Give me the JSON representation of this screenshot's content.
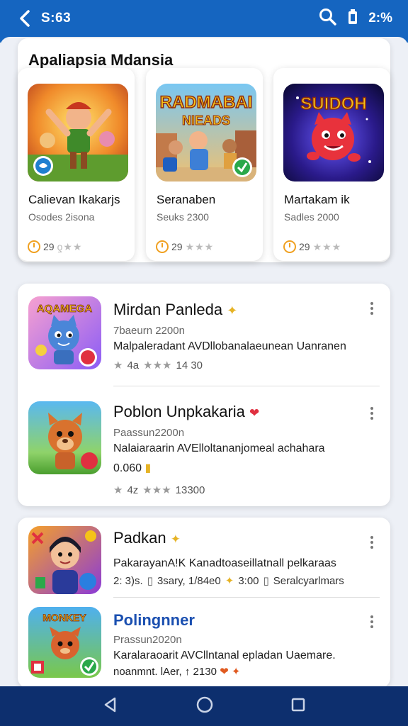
{
  "status_bar": {
    "title": "S:63",
    "battery_text": "2:%",
    "icons": [
      "back-arrow-icon",
      "search-icon",
      "battery-icon"
    ]
  },
  "featured": {
    "section_title": "Apaliapsia Mdansia",
    "items": [
      {
        "name": "Calievan Ikakarjs",
        "sub": "Osodes 2isona",
        "rating_text": "29"
      },
      {
        "name": "Seranaben",
        "sub": "Seuks 2300",
        "rating_text": "29"
      },
      {
        "name": "Martakam ik",
        "sub": "Sadles 2000",
        "rating_text": "29"
      }
    ],
    "art_texts": [
      "RADMABAI",
      "NIEADS",
      "SUIDOH"
    ]
  },
  "list_top": [
    {
      "title": "Mirdan Panleda",
      "line1": "7baeurn 2200n",
      "line2": "Malpaleradant AVDllobanalaeunean Uanranen",
      "meta_count": "14 30",
      "meta_left": "4a"
    },
    {
      "title": "Poblon Unpkakaria",
      "line1": "Paassun2200n",
      "line2": "Nalaiaraarin AVElloltananjomeal achahara",
      "line3": "0.060",
      "meta_count": "13300",
      "meta_left": "4z"
    }
  ],
  "list_bottom": [
    {
      "title": "Padkan",
      "line1": "PakarayanA!K Kanadtoaseillatnall pelkaraas",
      "meta": [
        "2: 3)s.",
        "3sary, 1/84e0",
        "3:00",
        "Seralcyarlmars"
      ]
    },
    {
      "title": "Polingnner",
      "line1": "Prassun2020n",
      "line2": "Karalaraoarit AVCllntanal epladan Uaemare.",
      "line3": "noanmnt. lAer, ↑ 2130"
    }
  ],
  "icon_texts": [
    "AQAMEGA",
    "MONKEY"
  ],
  "colors": {
    "status_bar": "#1565c0",
    "nav_bar": "#0d2f6e",
    "accent_blue": "#1a4fb0"
  }
}
